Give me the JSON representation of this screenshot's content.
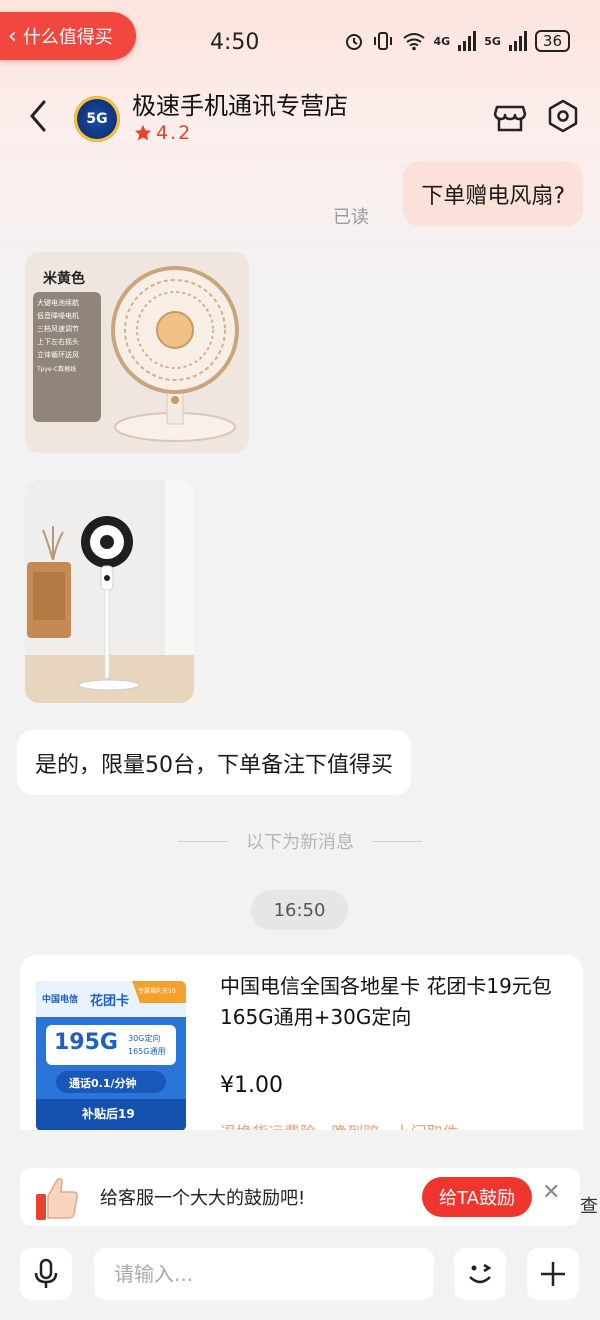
{
  "status_bar": {
    "back_app_label": "什么值得买",
    "time": "4:50",
    "net1": "4G",
    "net2": "5G",
    "battery": "36"
  },
  "header": {
    "shop_name": "极速手机通讯专营店",
    "avatar_text": "5G",
    "rating": "4.2"
  },
  "messages": {
    "outgoing_text": "下单赠电风扇?",
    "read_label": "已读",
    "image1": {
      "color_label": "米黄色",
      "features": [
        "大键电池续航",
        "低音降噪电机",
        "三档风速调节",
        "上下左右摇头",
        "立体循环送风"
      ],
      "cable_label": "Tpye-C数据线"
    },
    "reply_text": "是的，限量50台，下单备注下值得买",
    "new_messages_divider": "以下为新消息",
    "timestamp": "16:50"
  },
  "product": {
    "title": "中国电信全国各地星卡  花团卡19元包165G通用+30G定向",
    "price": "¥1.00",
    "more_text": "退换货运费险 · 晚到赔 · 上门取件",
    "image": {
      "brand": "中国电信",
      "card_name": "花团卡",
      "tag": "专属福利充50",
      "data_amount": "195G",
      "data_sub1": "30G定向",
      "data_sub2": "165G通用",
      "call_rate": "通话0.1/分钟",
      "subsidy": "补贴后19"
    }
  },
  "encourage": {
    "text": "给客服一个大大的鼓励吧!",
    "button": "给TA鼓励",
    "peek_text": "查"
  },
  "input_bar": {
    "placeholder": "请输入..."
  },
  "colors": {
    "accent": "#f0342e",
    "outgoing_bubble": "#fbe1d9",
    "background": "#f2f2f2"
  }
}
